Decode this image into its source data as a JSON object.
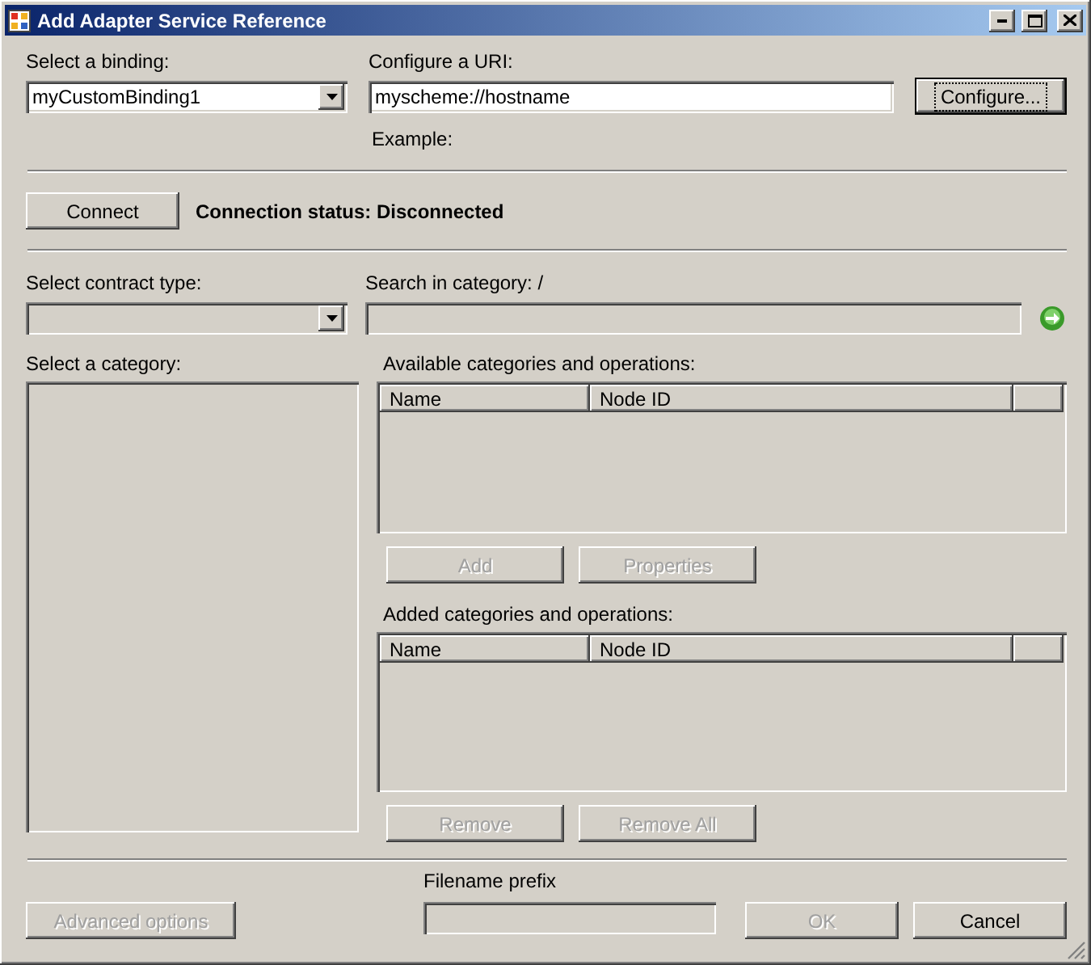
{
  "window": {
    "title": "Add Adapter Service Reference"
  },
  "binding": {
    "label": "Select a binding:",
    "value": "myCustomBinding1"
  },
  "uri": {
    "label": "Configure a URI:",
    "value": "myscheme://hostname",
    "example": "Example:"
  },
  "configure_button": {
    "label": "Configure...",
    "disabled": false,
    "focused": true
  },
  "connect_button": {
    "label": "Connect",
    "disabled": false
  },
  "connection_status": "Connection status: Disconnected",
  "contract_type": {
    "label": "Select contract type:",
    "disabled": true
  },
  "search": {
    "label": "Search in category: /",
    "disabled": true
  },
  "category": {
    "label": "Select a category:"
  },
  "available": {
    "label": "Available categories and operations:",
    "columns": [
      "Name",
      "Node ID"
    ],
    "buttons": [
      {
        "label": "Add",
        "disabled": true
      },
      {
        "label": "Properties",
        "disabled": true
      }
    ]
  },
  "added": {
    "label": "Added categories and operations:",
    "columns": [
      "Name",
      "Node ID"
    ],
    "buttons": [
      {
        "label": "Remove",
        "disabled": true
      },
      {
        "label": "Remove All",
        "disabled": true
      }
    ]
  },
  "filename_prefix": {
    "label": "Filename prefix"
  },
  "footer_buttons": [
    {
      "label": "Advanced options",
      "disabled": true
    },
    {
      "label": "OK",
      "disabled": true
    },
    {
      "label": "Cancel",
      "disabled": false
    }
  ]
}
